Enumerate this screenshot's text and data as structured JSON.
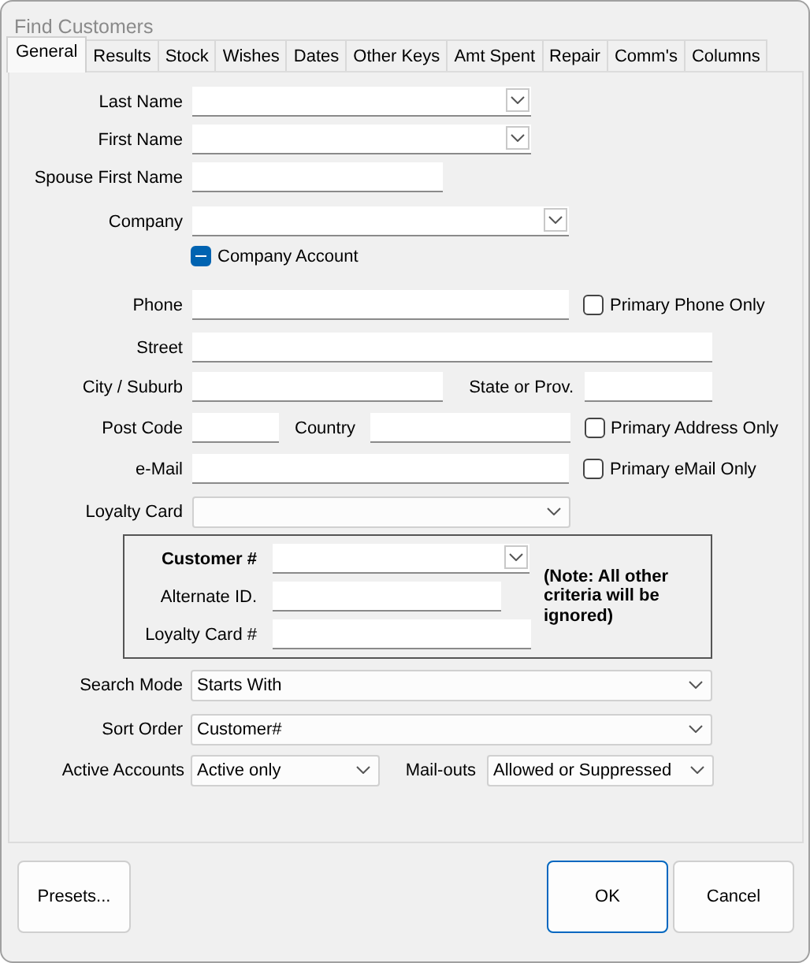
{
  "window": {
    "title": "Find Customers"
  },
  "tabs": [
    {
      "label": "General",
      "selected": true
    },
    {
      "label": "Results",
      "selected": false
    },
    {
      "label": "Stock",
      "selected": false
    },
    {
      "label": "Wishes",
      "selected": false
    },
    {
      "label": "Dates",
      "selected": false
    },
    {
      "label": "Other Keys",
      "selected": false
    },
    {
      "label": "Amt Spent",
      "selected": false
    },
    {
      "label": "Repair",
      "selected": false
    },
    {
      "label": "Comm's",
      "selected": false
    },
    {
      "label": "Columns",
      "selected": false
    }
  ],
  "rows": [
    {
      "kind": "fields",
      "items": [
        {
          "kind": "label",
          "text": "Last Name"
        },
        {
          "kind": "combo"
        }
      ]
    },
    {
      "kind": "fields",
      "items": [
        {
          "kind": "label",
          "text": "First Name"
        },
        {
          "kind": "combo"
        }
      ]
    },
    {
      "kind": "fields",
      "items": [
        {
          "kind": "label",
          "text": "Spouse First Name"
        },
        {
          "kind": "text"
        }
      ]
    },
    {
      "kind": "fields",
      "items": [
        {
          "kind": "label",
          "text": "Company"
        },
        {
          "kind": "combo"
        }
      ]
    },
    {
      "kind": "fields",
      "items": [
        {
          "kind": "checkbox",
          "text": "Company Account",
          "indeterminate": true
        }
      ]
    },
    {
      "kind": "fields",
      "items": [
        {
          "kind": "label",
          "text": "Phone"
        },
        {
          "kind": "text"
        },
        {
          "kind": "checkbox",
          "text": "Primary Phone Only",
          "checked": false
        }
      ]
    },
    {
      "kind": "fields",
      "items": [
        {
          "kind": "label",
          "text": "Street"
        },
        {
          "kind": "text"
        }
      ]
    },
    {
      "kind": "fields",
      "items": [
        {
          "kind": "label",
          "text": "City / Suburb"
        },
        {
          "kind": "text"
        },
        {
          "kind": "label",
          "text": "State or Prov."
        },
        {
          "kind": "text"
        }
      ]
    },
    {
      "kind": "fields",
      "items": [
        {
          "kind": "label",
          "text": "Post Code"
        },
        {
          "kind": "text"
        },
        {
          "kind": "label",
          "text": "Country"
        },
        {
          "kind": "text"
        },
        {
          "kind": "checkbox",
          "text": "Primary Address Only",
          "checked": false
        }
      ]
    },
    {
      "kind": "fields",
      "items": [
        {
          "kind": "label",
          "text": "e-Mail"
        },
        {
          "kind": "text"
        },
        {
          "kind": "checkbox",
          "text": "Primary eMail Only",
          "checked": false
        }
      ]
    },
    {
      "kind": "fields",
      "items": [
        {
          "kind": "label",
          "text": "Loyalty Card"
        },
        {
          "kind": "select"
        }
      ]
    },
    {
      "kind": "group",
      "rows": [
        {
          "items": [
            {
              "kind": "label",
              "text": "Customer #",
              "bold": true
            },
            {
              "kind": "combo"
            }
          ]
        },
        {
          "items": [
            {
              "kind": "label",
              "text": "Alternate ID."
            },
            {
              "kind": "text"
            }
          ]
        },
        {
          "items": [
            {
              "kind": "label",
              "text": "Loyalty Card #"
            },
            {
              "kind": "text"
            }
          ]
        }
      ],
      "note": "(Note: All other criteria will be ignored)"
    },
    {
      "kind": "fields",
      "items": [
        {
          "kind": "label",
          "text": "Search Mode"
        },
        {
          "kind": "select",
          "value": "Starts With"
        }
      ]
    },
    {
      "kind": "fields",
      "items": [
        {
          "kind": "label",
          "text": "Sort Order"
        },
        {
          "kind": "select",
          "value": "Customer#"
        }
      ]
    },
    {
      "kind": "fields",
      "items": [
        {
          "kind": "label",
          "text": "Active Accounts"
        },
        {
          "kind": "select",
          "value": "Active only"
        },
        {
          "kind": "label",
          "text": "Mail-outs"
        },
        {
          "kind": "select",
          "value": "Allowed or Suppressed"
        }
      ]
    }
  ],
  "buttons": [
    {
      "label": "Presets...",
      "default": false
    },
    {
      "label": "OK",
      "default": true
    },
    {
      "label": "Cancel",
      "default": false
    }
  ]
}
